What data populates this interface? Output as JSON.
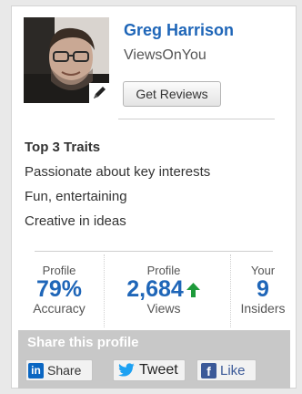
{
  "profile": {
    "name": "Greg Harrison",
    "company": "ViewsOnYou",
    "get_reviews_label": "Get Reviews"
  },
  "traits": {
    "title": "Top 3 Traits",
    "items": [
      "Passionate about key interests",
      "Fun, entertaining",
      "Creative in ideas"
    ]
  },
  "stats": [
    {
      "top_label": "Profile",
      "value": "79%",
      "bottom_label": "Accuracy"
    },
    {
      "top_label": "Profile",
      "value": "2,684",
      "bottom_label": "Views",
      "trend": "up"
    },
    {
      "top_label": "Your",
      "value": "9",
      "bottom_label": "Insiders"
    }
  ],
  "share": {
    "title": "Share this profile",
    "linkedin_label": "Share",
    "linkedin_logo": "in",
    "twitter_label": "Tweet",
    "facebook_label": "Like",
    "facebook_logo": "f"
  },
  "colors": {
    "link_blue": "#1f66b8",
    "trend_green": "#1e9a3a",
    "share_bar": "#c8c8c8",
    "linkedin_blue": "#0a66c2",
    "twitter_blue": "#1da1f2",
    "facebook_blue": "#3b5998"
  },
  "icons": {
    "avatar_edit": "pencil-icon",
    "views_trend": "up-arrow-icon",
    "linkedin": "linkedin-icon",
    "twitter": "twitter-bird-icon",
    "facebook": "facebook-icon"
  }
}
